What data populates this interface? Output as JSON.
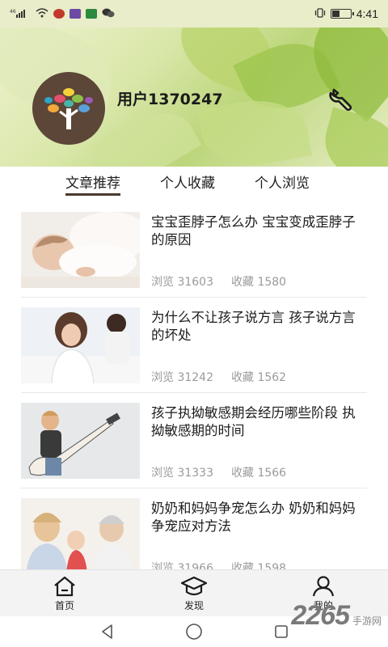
{
  "status_bar": {
    "signal": "⁴⁶ull",
    "time": "4:41"
  },
  "profile": {
    "username": "用户1370247"
  },
  "tabs": [
    {
      "label": "文章推荐",
      "active": true
    },
    {
      "label": "个人收藏",
      "active": false
    },
    {
      "label": "个人浏览",
      "active": false
    }
  ],
  "articles": [
    {
      "title": "宝宝歪脖子怎么办  宝宝变成歪脖子的原因",
      "views": "浏览 31603",
      "favorites": "收藏 1580"
    },
    {
      "title": "为什么不让孩子说方言 孩子说方言的坏处",
      "views": "浏览 31242",
      "favorites": "收藏 1562"
    },
    {
      "title": "孩子执拗敏感期会经历哪些阶段 执拗敏感期的时间",
      "views": "浏览 31333",
      "favorites": "收藏 1566"
    },
    {
      "title": "奶奶和妈妈争宠怎么办 奶奶和妈妈争宠应对方法",
      "views": "浏览 31966",
      "favorites": "收藏 1598"
    }
  ],
  "bottom_nav": [
    {
      "label": "首页",
      "icon": "home-icon"
    },
    {
      "label": "发现",
      "icon": "graduation-cap-icon"
    },
    {
      "label": "我的",
      "icon": "user-icon"
    }
  ],
  "watermark": {
    "number": "2265",
    "text": "手游网"
  },
  "colors": {
    "accent": "#4a3a30",
    "meta_text": "#9a9a9a",
    "avatar_bg": "#5c4637"
  }
}
